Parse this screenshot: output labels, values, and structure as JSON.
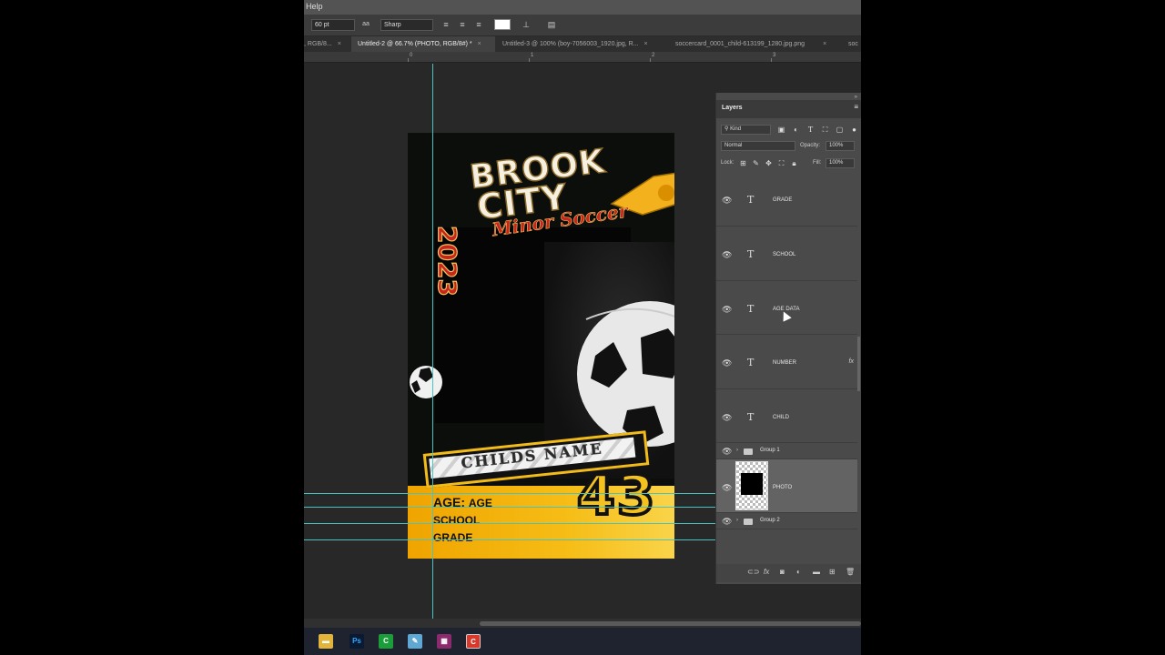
{
  "menubar": {
    "help_label": "Help"
  },
  "options": {
    "font_size": "60 pt",
    "antialias_icon": "aa",
    "antialias": "Sharp",
    "color_swatch": "#ffffff"
  },
  "tabs": [
    {
      "label": ", RGB/8...",
      "close": "×"
    },
    {
      "label": "Untitled-2 @ 66.7% (PHOTO, RGB/8#) *",
      "close": "×",
      "active": true
    },
    {
      "label": "Untitled-3 @ 100% (boy-7056003_1920.jpg, R...",
      "close": "×"
    },
    {
      "label": "soccercard_0001_child-613199_1280.jpg.png",
      "close": "×"
    },
    {
      "label": "soc"
    }
  ],
  "ruler": {
    "labels": [
      "0",
      "1",
      "2",
      "3"
    ]
  },
  "card": {
    "brand_line1": "BROOK",
    "brand_line2": "CITY",
    "brand_line3": "Minor Soccer",
    "year": "2023",
    "child_name": "CHILDS NAME",
    "number": "43",
    "age_label": "AGE:",
    "age_value": "AGE",
    "school": "SCHOOL",
    "grade": "GRADE"
  },
  "layers_panel": {
    "title": "Layers",
    "filter_kind": "Kind",
    "blend_mode": "Normal",
    "opacity_label": "Opacity:",
    "opacity_value": "100%",
    "lock_label": "Lock:",
    "fill_label": "Fill:",
    "fill_value": "100%",
    "layers": [
      {
        "name": "GRADE",
        "type": "text"
      },
      {
        "name": "SCHOOL",
        "type": "text"
      },
      {
        "name": "AGE DATA",
        "type": "text"
      },
      {
        "name": "NUMBER",
        "type": "text",
        "fx": "fx"
      },
      {
        "name": "CHILD",
        "type": "text"
      },
      {
        "name": "Group 1",
        "type": "group"
      },
      {
        "name": "PHOTO",
        "type": "image",
        "selected": true
      },
      {
        "name": "Group 2",
        "type": "group"
      }
    ]
  },
  "taskbar": {
    "apps": [
      "file-explorer",
      "photoshop",
      "camtasia",
      "notepad",
      "winrar",
      "recorder"
    ],
    "ps_label": "Ps"
  },
  "colors": {
    "accent_yellow": "#f6bd16",
    "guide": "#49c2c2",
    "brand_red": "#c8251e"
  }
}
